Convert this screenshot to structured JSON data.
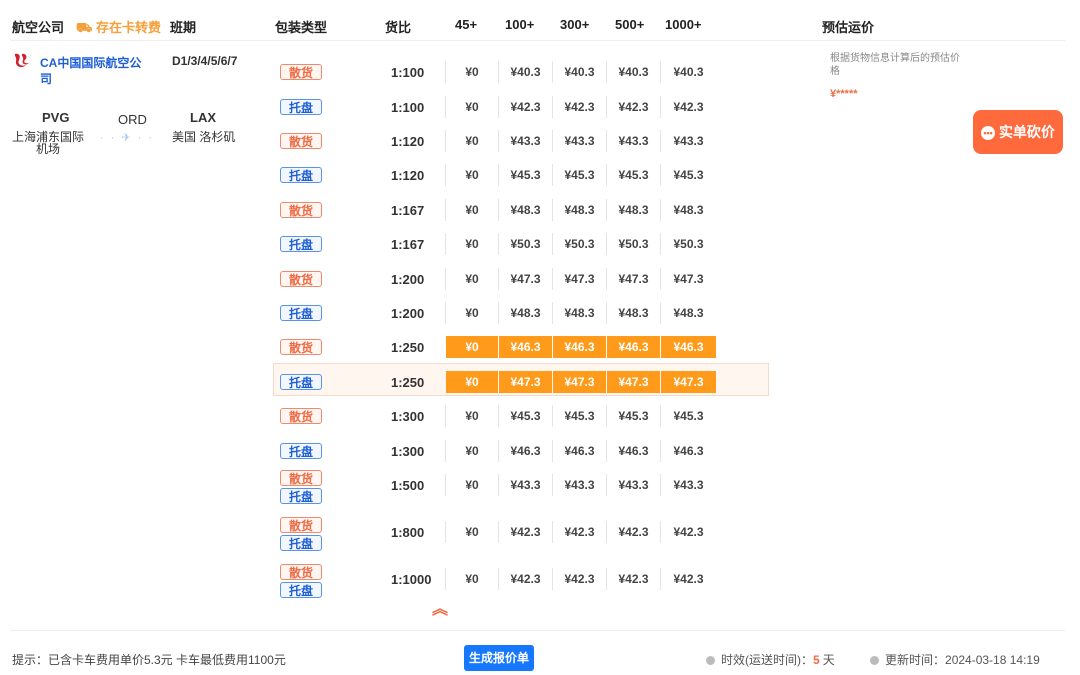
{
  "header": {
    "airline_col": "航空公司",
    "truck_fee": "存在卡转费",
    "schedule_col": "班期",
    "package_col": "包装类型",
    "ratio_col": "货比",
    "w45": "45+",
    "w100": "100+",
    "w300": "300+",
    "w500": "500+",
    "w1000": "1000+",
    "estimate_col": "预估运价"
  },
  "route": {
    "airline": "CA中国国际航空公司",
    "schedule": "D1/3/4/5/6/7",
    "origin_code": "PVG",
    "origin_city": "上海浦东国际机场",
    "transit_code": "ORD",
    "dest_code": "LAX",
    "dest_city": "美国 洛杉矶"
  },
  "labels": {
    "bulk": "散货",
    "pallet": "托盘"
  },
  "rows": [
    {
      "type": "bulk",
      "ratio": "1:100",
      "p": [
        "¥0",
        "¥40.3",
        "¥40.3",
        "¥40.3",
        "¥40.3"
      ]
    },
    {
      "type": "pallet",
      "ratio": "1:100",
      "p": [
        "¥0",
        "¥42.3",
        "¥42.3",
        "¥42.3",
        "¥42.3"
      ]
    },
    {
      "type": "bulk",
      "ratio": "1:120",
      "p": [
        "¥0",
        "¥43.3",
        "¥43.3",
        "¥43.3",
        "¥43.3"
      ]
    },
    {
      "type": "pallet",
      "ratio": "1:120",
      "p": [
        "¥0",
        "¥45.3",
        "¥45.3",
        "¥45.3",
        "¥45.3"
      ]
    },
    {
      "type": "bulk",
      "ratio": "1:167",
      "p": [
        "¥0",
        "¥48.3",
        "¥48.3",
        "¥48.3",
        "¥48.3"
      ]
    },
    {
      "type": "pallet",
      "ratio": "1:167",
      "p": [
        "¥0",
        "¥50.3",
        "¥50.3",
        "¥50.3",
        "¥50.3"
      ]
    },
    {
      "type": "bulk",
      "ratio": "1:200",
      "p": [
        "¥0",
        "¥47.3",
        "¥47.3",
        "¥47.3",
        "¥47.3"
      ]
    },
    {
      "type": "pallet",
      "ratio": "1:200",
      "p": [
        "¥0",
        "¥48.3",
        "¥48.3",
        "¥48.3",
        "¥48.3"
      ]
    },
    {
      "type": "bulk",
      "ratio": "1:250",
      "p": [
        "¥0",
        "¥46.3",
        "¥46.3",
        "¥46.3",
        "¥46.3"
      ],
      "highlight": true
    },
    {
      "type": "pallet",
      "ratio": "1:250",
      "p": [
        "¥0",
        "¥47.3",
        "¥47.3",
        "¥47.3",
        "¥47.3"
      ],
      "highlight": true
    },
    {
      "type": "bulk",
      "ratio": "1:300",
      "p": [
        "¥0",
        "¥45.3",
        "¥45.3",
        "¥45.3",
        "¥45.3"
      ]
    },
    {
      "type": "pallet",
      "ratio": "1:300",
      "p": [
        "¥0",
        "¥46.3",
        "¥46.3",
        "¥46.3",
        "¥46.3"
      ]
    },
    {
      "type": "both",
      "ratio": "1:500",
      "p": [
        "¥0",
        "¥43.3",
        "¥43.3",
        "¥43.3",
        "¥43.3"
      ]
    },
    {
      "type": "both",
      "ratio": "1:800",
      "p": [
        "¥0",
        "¥42.3",
        "¥42.3",
        "¥42.3",
        "¥42.3"
      ]
    },
    {
      "type": "both",
      "ratio": "1:1000",
      "p": [
        "¥0",
        "¥42.3",
        "¥42.3",
        "¥42.3",
        "¥42.3"
      ]
    }
  ],
  "estimate": {
    "note": "根据货物信息计算后的预估价格",
    "price": "¥*****",
    "bargain_label": "实单砍价"
  },
  "footer": {
    "hint": "提示：已含卡车费用单价5.3元 卡车最低费用1100元",
    "quote_button": "生成报价单",
    "transit_label": "时效(运送时间)：",
    "transit_days": "5",
    "transit_unit": "天",
    "updated_label": "更新时间：",
    "updated_value": "2024-03-18 14:19"
  },
  "colors": {
    "accent": "#ff9a1a",
    "bargain": "#ff6a3d",
    "link": "#1e5fd6"
  }
}
